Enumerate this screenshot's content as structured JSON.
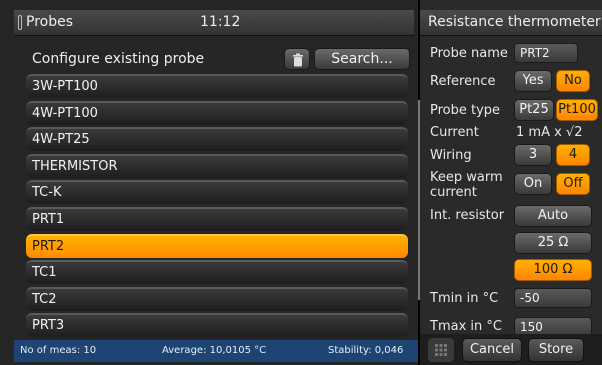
{
  "header": {
    "title": "Probes",
    "time": "11:12"
  },
  "list_panel": {
    "heading": "Configure existing probe",
    "search_label": "Search...",
    "items": [
      {
        "label": "3W-PT100",
        "selected": false
      },
      {
        "label": "4W-PT100",
        "selected": false
      },
      {
        "label": "4W-PT25",
        "selected": false
      },
      {
        "label": "THERMISTOR",
        "selected": false
      },
      {
        "label": "TC-K",
        "selected": false
      },
      {
        "label": "PRT1",
        "selected": false
      },
      {
        "label": "PRT2",
        "selected": true
      },
      {
        "label": "TC1",
        "selected": false
      },
      {
        "label": "TC2",
        "selected": false
      },
      {
        "label": "PRT3",
        "selected": false
      }
    ]
  },
  "status": {
    "meas": "No of meas: 10",
    "average": "Average: 10,0105 °C",
    "stability": "Stability: 0,046"
  },
  "detail": {
    "title": "Resistance thermometer",
    "probe_name_label": "Probe name",
    "probe_name_value": "PRT2",
    "reference_label": "Reference",
    "reference_yes": "Yes",
    "reference_no": "No",
    "probe_type_label": "Probe type",
    "probe_type_pt25": "Pt25",
    "probe_type_pt100": "Pt100",
    "current_label": "Current",
    "current_value": "1 mA x √2",
    "wiring_label": "Wiring",
    "wiring_3": "3",
    "wiring_4": "4",
    "keep_warm_label_1": "Keep warm",
    "keep_warm_label_2": "current",
    "keep_on": "On",
    "keep_off": "Off",
    "int_resistor_label": "Int. resistor",
    "resistor_auto": "Auto",
    "resistor_25": "25 Ω",
    "resistor_100": "100 Ω",
    "tmin_label": "Tmin in °C",
    "tmin_value": "-50",
    "tmax_label": "Tmax in °C",
    "tmax_value": "150"
  },
  "footer": {
    "cancel_label": "Cancel",
    "store_label": "Store"
  },
  "colors": {
    "accent": "#ff9a00",
    "status_bar": "#1e4474"
  },
  "icons": {
    "probe": "thermometer-probe-icon",
    "trash": "trash-icon",
    "grid": "grid-icon"
  }
}
